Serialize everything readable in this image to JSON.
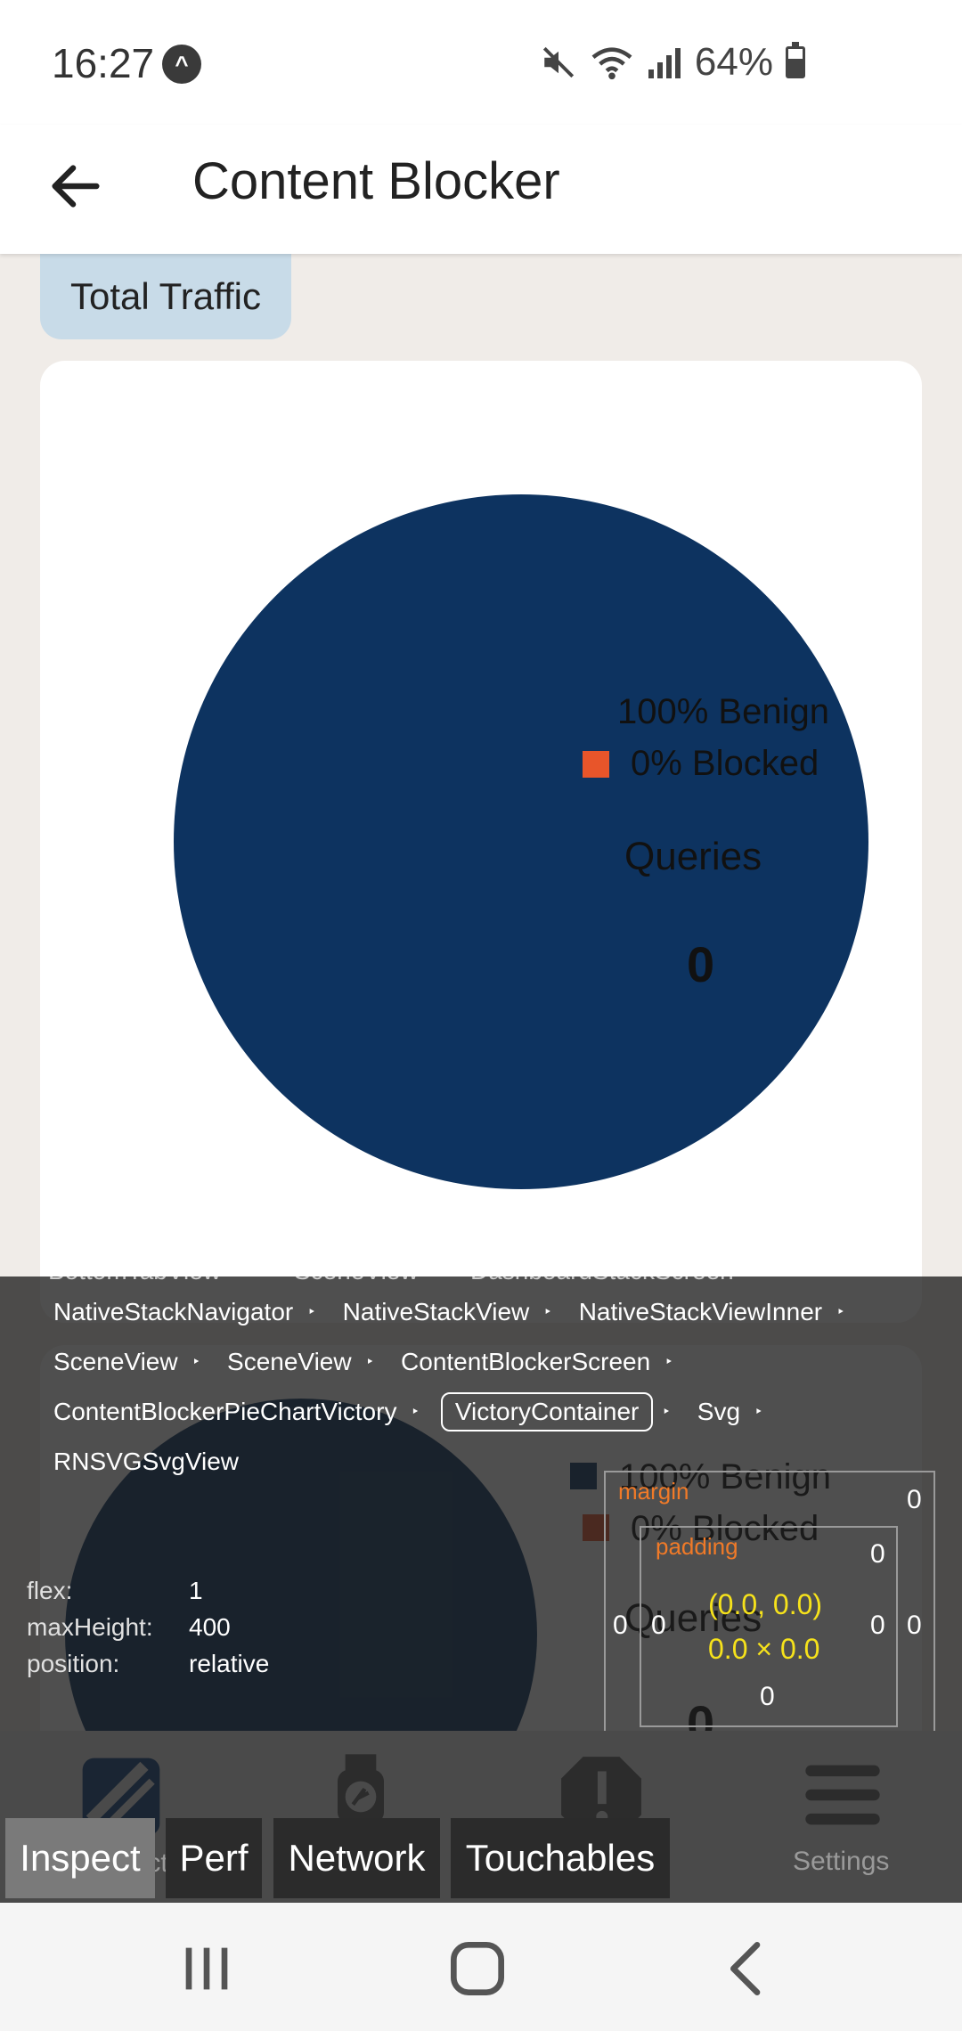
{
  "status_bar": {
    "time": "16:27",
    "battery_percent": "64%",
    "battery_level": 0.64,
    "icons": [
      "app-notification-icon",
      "mute-icon",
      "wifi-icon",
      "signal-icon",
      "battery-icon"
    ]
  },
  "header": {
    "title": "Content Blocker",
    "back_icon": "arrow-left-icon"
  },
  "main": {
    "chip_label": "Total Traffic",
    "chart": {
      "legend": [
        {
          "label": "100% Benign",
          "color": "#0d3360"
        },
        {
          "label": "0% Blocked",
          "color": "#e8552a"
        }
      ],
      "center_label": "Queries",
      "center_value": "0"
    }
  },
  "chart_data": {
    "type": "pie",
    "categories": [
      "Benign",
      "Blocked"
    ],
    "values": [
      100,
      0
    ],
    "colors": [
      "#0d3360",
      "#e8552a"
    ],
    "legend_labels": [
      "100% Benign",
      "0% Blocked"
    ],
    "annotations": [
      "Queries",
      "0"
    ]
  },
  "inspector": {
    "hidden_crumbs": [
      "BottomTabView",
      "SceneView",
      "DashboardStackScreen"
    ],
    "breadcrumbs": [
      "NativeStackNavigator",
      "NativeStackView",
      "NativeStackViewInner",
      "SceneView",
      "SceneView",
      "ContentBlockerScreen",
      "ContentBlockerPieChartVictory",
      "VictoryContainer",
      "Svg",
      "RNSVGSvgView"
    ],
    "selected_crumb": "VictoryContainer",
    "separator": "‣",
    "props": [
      {
        "key": "flex:",
        "value": "1"
      },
      {
        "key": "maxHeight:",
        "value": "400"
      },
      {
        "key": "position:",
        "value": "relative"
      }
    ],
    "box_model": {
      "margin_label": "margin",
      "padding_label": "padding",
      "margin_top": "0",
      "margin_left": "0",
      "margin_right": "0",
      "margin_bottom": "0",
      "padding_top": "0",
      "padding_left": "0",
      "padding_right": "0",
      "padding_bottom": "0",
      "position": "(0.0, 0.0)",
      "size": "0.0 × 0.0"
    }
  },
  "devtools": {
    "tabs": [
      {
        "label": "Inspect",
        "active": true
      },
      {
        "label": "Perf",
        "active": false
      },
      {
        "label": "Network",
        "active": false
      },
      {
        "label": "Touchables",
        "active": false
      }
    ],
    "hidden_labels": [
      "Inspect"
    ],
    "settings_label": "Settings",
    "icons": [
      "inspect-icon",
      "perf-watch-icon",
      "touchables-icon",
      "settings-menu-icon"
    ]
  },
  "nav_bar": {
    "icons": [
      "recent-apps-icon",
      "home-icon",
      "back-icon"
    ]
  }
}
